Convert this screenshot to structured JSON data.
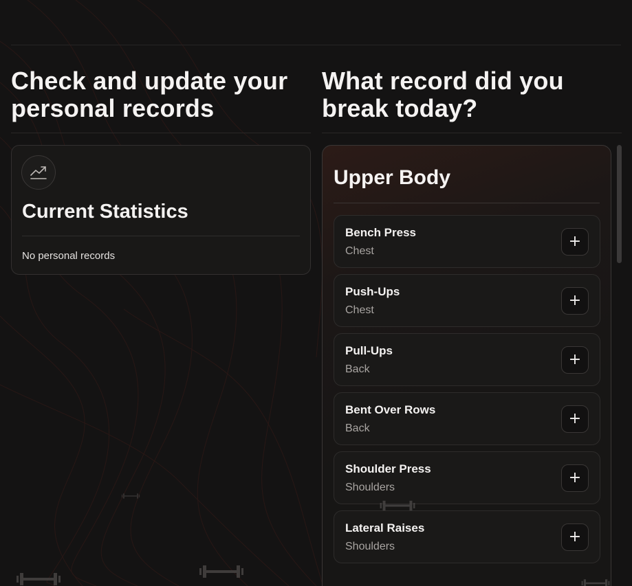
{
  "left_heading": "Check and update your personal records",
  "right_heading": "What record did you break today?",
  "stats": {
    "icon": "trending-up-icon",
    "title": "Current Statistics",
    "empty_text": "No personal records"
  },
  "records": {
    "section_title": "Upper Body",
    "add_label": "+",
    "exercises": [
      {
        "name": "Bench Press",
        "muscle": "Chest"
      },
      {
        "name": "Push-Ups",
        "muscle": "Chest"
      },
      {
        "name": "Pull-Ups",
        "muscle": "Back"
      },
      {
        "name": "Bent Over Rows",
        "muscle": "Back"
      },
      {
        "name": "Shoulder Press",
        "muscle": "Shoulders"
      },
      {
        "name": "Lateral Raises",
        "muscle": "Shoulders"
      }
    ]
  },
  "colors": {
    "background": "#141313",
    "card": "#191817",
    "accent_glow": "#2c1b17"
  }
}
